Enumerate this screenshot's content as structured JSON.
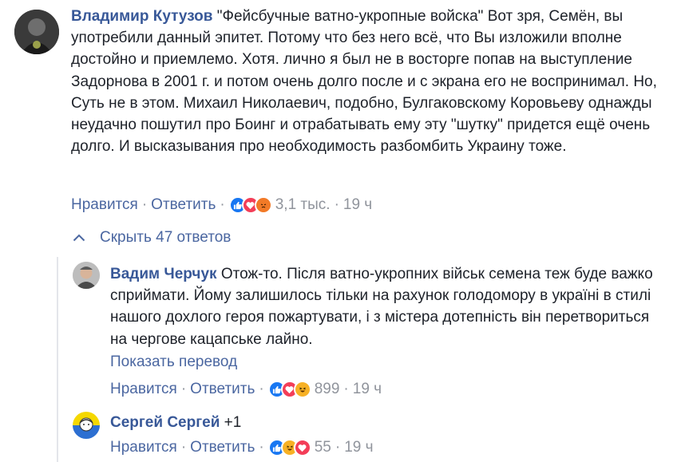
{
  "comments": [
    {
      "author": "Владимир Кутузов",
      "text": "\"Фейсбучные ватно-укропные войска\" Вот зря, Семён, вы употребили данный эпитет. Потому что без него всё, что Вы изложили вполне достойно и приемлемо. Хотя. лично я был не в восторге попав на выступление Задорнова в 2001 г. и потом очень долго после и с экрана его не воспринимал. Но, Суть не в этом. Михаил Николаевич, подобно, Булгаковскому Коровьеву однажды неудачно пошутил про Боинг и отрабатывать ему эту \"шутку\" придется ещё очень долго. И высказывания про необходимость разбомбить Украину тоже.",
      "like": "Нравится",
      "reply": "Ответить",
      "reactions": [
        "like",
        "love",
        "angry"
      ],
      "count": "3,1 тыс.",
      "time": "19 ч"
    },
    {
      "author": "Вадим Черчук",
      "text": "Отож-то. Після ватно-укропних військ семена теж буде важко сприймати. Йому залишилось тільки на рахунок голодомору в україні в стилі нашого дохлого героя пожартувати, і з містера дотепність він перетвориться на чергове кацапське лайно.",
      "translate": "Показать перевод",
      "like": "Нравится",
      "reply": "Ответить",
      "reactions": [
        "like",
        "love",
        "haha"
      ],
      "count": "899",
      "time": "19 ч"
    },
    {
      "author": "Сергей Сергей",
      "text": "+1",
      "like": "Нравится",
      "reply": "Ответить",
      "reactions": [
        "like",
        "haha",
        "love"
      ],
      "count": "55",
      "time": "19 ч"
    }
  ],
  "replies_toggle": "Скрыть 47 ответов",
  "colors": {
    "link": "#4b67a1",
    "author": "#385898",
    "meta": "#90949c",
    "like": "#1877f2",
    "love": "#f33e58",
    "haha": "#f7b125",
    "angry": "#e9710f"
  }
}
